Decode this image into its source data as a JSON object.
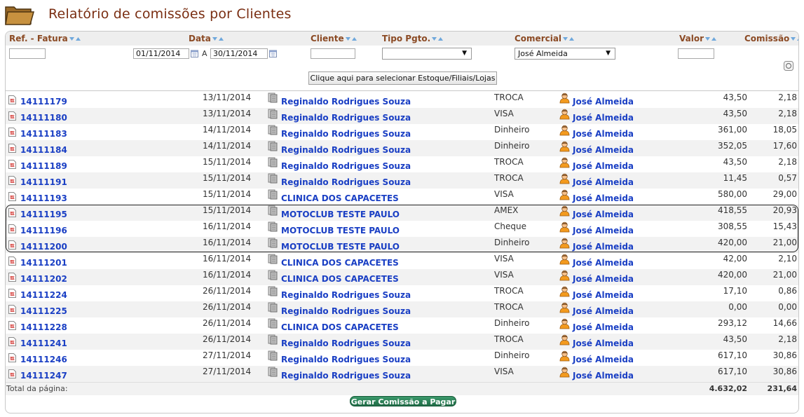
{
  "page": {
    "title": "Relatório de comissões por Clientes"
  },
  "columns": {
    "ref": "Ref. - Fatura",
    "data": "Data",
    "cliente": "Cliente",
    "tipo": "Tipo Pgto.",
    "comercial": "Comercial",
    "valor": "Valor",
    "comissao": "Comissão"
  },
  "filters": {
    "ref_value": "",
    "date_from": "01/11/2014",
    "date_sep": "A",
    "date_to": "30/11/2014",
    "cliente_value": "",
    "tipo_value": "",
    "comercial_value": "José Almeida",
    "valor_value": "",
    "select_button": "Clique aqui para selecionar Estoque/Filiais/Lojas"
  },
  "rows": [
    {
      "ref": "14111179",
      "date": "13/11/2014",
      "client": "Reginaldo Rodrigues Souza",
      "pay": "TROCA",
      "comm": "José Almeida",
      "val": "43,50",
      "com": "2,18"
    },
    {
      "ref": "14111180",
      "date": "13/11/2014",
      "client": "Reginaldo Rodrigues Souza",
      "pay": "VISA",
      "comm": "José Almeida",
      "val": "43,50",
      "com": "2,18"
    },
    {
      "ref": "14111183",
      "date": "14/11/2014",
      "client": "Reginaldo Rodrigues Souza",
      "pay": "Dinheiro",
      "comm": "José Almeida",
      "val": "361,00",
      "com": "18,05"
    },
    {
      "ref": "14111184",
      "date": "14/11/2014",
      "client": "Reginaldo Rodrigues Souza",
      "pay": "Dinheiro",
      "comm": "José Almeida",
      "val": "352,05",
      "com": "17,60"
    },
    {
      "ref": "14111189",
      "date": "15/11/2014",
      "client": "Reginaldo Rodrigues Souza",
      "pay": "TROCA",
      "comm": "José Almeida",
      "val": "43,50",
      "com": "2,18"
    },
    {
      "ref": "14111191",
      "date": "15/11/2014",
      "client": "Reginaldo Rodrigues Souza",
      "pay": "TROCA",
      "comm": "José Almeida",
      "val": "11,45",
      "com": "0,57"
    },
    {
      "ref": "14111193",
      "date": "15/11/2014",
      "client": "CLINICA DOS CAPACETES",
      "pay": "VISA",
      "comm": "José Almeida",
      "val": "580,00",
      "com": "29,00"
    },
    {
      "ref": "14111195",
      "date": "15/11/2014",
      "client": "MOTOCLUB TESTE PAULO",
      "pay": "AMEX",
      "comm": "José Almeida",
      "val": "418,55",
      "com": "20,93"
    },
    {
      "ref": "14111196",
      "date": "16/11/2014",
      "client": "MOTOCLUB TESTE PAULO",
      "pay": "Cheque",
      "comm": "José Almeida",
      "val": "308,55",
      "com": "15,43"
    },
    {
      "ref": "14111200",
      "date": "16/11/2014",
      "client": "MOTOCLUB TESTE PAULO",
      "pay": "Dinheiro",
      "comm": "José Almeida",
      "val": "420,00",
      "com": "21,00"
    },
    {
      "ref": "14111201",
      "date": "16/11/2014",
      "client": "CLINICA DOS CAPACETES",
      "pay": "VISA",
      "comm": "José Almeida",
      "val": "42,00",
      "com": "2,10"
    },
    {
      "ref": "14111202",
      "date": "16/11/2014",
      "client": "CLINICA DOS CAPACETES",
      "pay": "VISA",
      "comm": "José Almeida",
      "val": "420,00",
      "com": "21,00"
    },
    {
      "ref": "14111224",
      "date": "26/11/2014",
      "client": "Reginaldo Rodrigues Souza",
      "pay": "TROCA",
      "comm": "José Almeida",
      "val": "17,10",
      "com": "0,86"
    },
    {
      "ref": "14111225",
      "date": "26/11/2014",
      "client": "Reginaldo Rodrigues Souza",
      "pay": "TROCA",
      "comm": "José Almeida",
      "val": "0,00",
      "com": "0,00"
    },
    {
      "ref": "14111228",
      "date": "26/11/2014",
      "client": "CLINICA DOS CAPACETES",
      "pay": "Dinheiro",
      "comm": "José Almeida",
      "val": "293,12",
      "com": "14,66"
    },
    {
      "ref": "14111241",
      "date": "26/11/2014",
      "client": "Reginaldo Rodrigues Souza",
      "pay": "TROCA",
      "comm": "José Almeida",
      "val": "43,50",
      "com": "2,18"
    },
    {
      "ref": "14111246",
      "date": "27/11/2014",
      "client": "Reginaldo Rodrigues Souza",
      "pay": "Dinheiro",
      "comm": "José Almeida",
      "val": "617,10",
      "com": "30,86"
    },
    {
      "ref": "14111247",
      "date": "27/11/2014",
      "client": "Reginaldo Rodrigues Souza",
      "pay": "VISA",
      "comm": "José Almeida",
      "val": "617,10",
      "com": "30,86"
    }
  ],
  "totals": {
    "label": "Total da página:",
    "valor": "4.632,02",
    "comissao": "231,64"
  },
  "actions": {
    "generate": "Gerar Comissão a Pagar"
  },
  "icons": {
    "folder": "folder-icon",
    "sort": "sort-arrows-icon",
    "calendar": "calendar-icon",
    "clear": "clear-filter-icon",
    "document": "document-icon",
    "client": "client-icon",
    "person": "person-icon"
  },
  "colors": {
    "title": "#7a2e12",
    "header_text": "#8b4a24",
    "link": "#1a3fc4",
    "button": "#1f6a45"
  }
}
